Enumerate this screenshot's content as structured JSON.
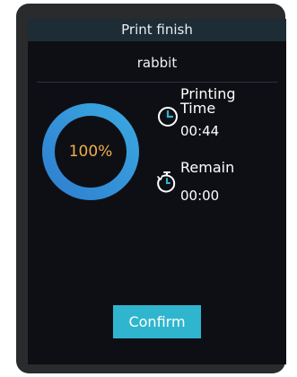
{
  "header": {
    "title": "Print finish"
  },
  "file": {
    "name": "rabbit"
  },
  "progress": {
    "label": "100%",
    "fraction": 1.0
  },
  "printing_time": {
    "label_line1": "Printing",
    "label_line2": "Time",
    "value": "00:44"
  },
  "remain": {
    "label": "Remain",
    "value": "00:00"
  },
  "actions": {
    "confirm_label": "Confirm"
  },
  "colors": {
    "accent": "#2fb6ce",
    "progress_text": "#f0b04c",
    "ring_start": "#2f7fd0",
    "ring_end": "#3aa8e0",
    "background": "#0e0f15",
    "title_bar": "#1d2c35"
  },
  "icons": {
    "printing_time": "clock-icon",
    "remain": "stopwatch-icon"
  }
}
